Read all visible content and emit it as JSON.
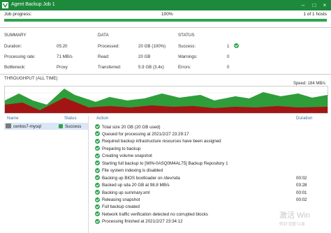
{
  "window": {
    "title": "Agent Backup Job 1"
  },
  "progress": {
    "label": "Job progress:",
    "percent_text": "100%",
    "hosts_text": "1 of 1 hosts",
    "fraction": 1.0
  },
  "summary": {
    "title": "SUMMARY",
    "rows": [
      {
        "label": "Duration:",
        "value": "05:20"
      },
      {
        "label": "Processing rate:",
        "value": "71 MB/s"
      },
      {
        "label": "Bottleneck:",
        "value": "Proxy"
      }
    ]
  },
  "data": {
    "title": "DATA",
    "rows": [
      {
        "label": "Processed:",
        "value": "20 GB (100%)"
      },
      {
        "label": "Read:",
        "value": "20 GB"
      },
      {
        "label": "Transferred:",
        "value": "5.9 GB (3.4x)"
      }
    ]
  },
  "status": {
    "title": "STATUS",
    "rows": [
      {
        "label": "Success:",
        "value": "1"
      },
      {
        "label": "Warnings:",
        "value": "0"
      },
      {
        "label": "Errors:",
        "value": "0"
      }
    ]
  },
  "throughput": {
    "title": "THROUGHPUT (ALL TIME)",
    "speed": "Speed: 184 MB/s"
  },
  "jobs": {
    "headers": {
      "name": "Name",
      "status": "Status"
    },
    "rows": [
      {
        "name": "centos7-mysql",
        "status": "Success"
      }
    ]
  },
  "log": {
    "headers": {
      "action": "Action",
      "duration": "Duration"
    },
    "rows": [
      {
        "text": "Total size 20 GB (20 GB used)",
        "duration": ""
      },
      {
        "text": "Queued for processing at 2021/2/27 23:29:17",
        "duration": ""
      },
      {
        "text": "Required backup infrastructure resources have been assigned",
        "duration": ""
      },
      {
        "text": "Preparing to backup",
        "duration": ""
      },
      {
        "text": "Creating volume snapshot",
        "duration": ""
      },
      {
        "text": "Starting full backup to [WIN-0ASQ0M4AL75] Backup Repository 1",
        "duration": ""
      },
      {
        "text": "File system indexing is disabled",
        "duration": ""
      },
      {
        "text": "Backing up BIOS bootloader on /dev/sda",
        "duration": "00:02"
      },
      {
        "text": "Backed up sda 20 GB at 98.8 MB/s",
        "duration": "03:28"
      },
      {
        "text": "Backing up summary.xml",
        "duration": "00:01"
      },
      {
        "text": "Releasing snapshot",
        "duration": "00:02"
      },
      {
        "text": "Full backup created",
        "duration": ""
      },
      {
        "text": "Network traffic verification detected no corrupted blocks",
        "duration": ""
      },
      {
        "text": "Processing finished at 2021/2/27 23:34:12",
        "duration": ""
      }
    ]
  },
  "watermark": {
    "line1": "激活 Win",
    "line2": "转到“设置”以激"
  },
  "colors": {
    "title_bar": "#1d8a3b",
    "progress": "#2ea44f",
    "read_area": "#2f9e3a",
    "transfer_area": "#a31515",
    "selection": "#d9e6f7"
  }
}
